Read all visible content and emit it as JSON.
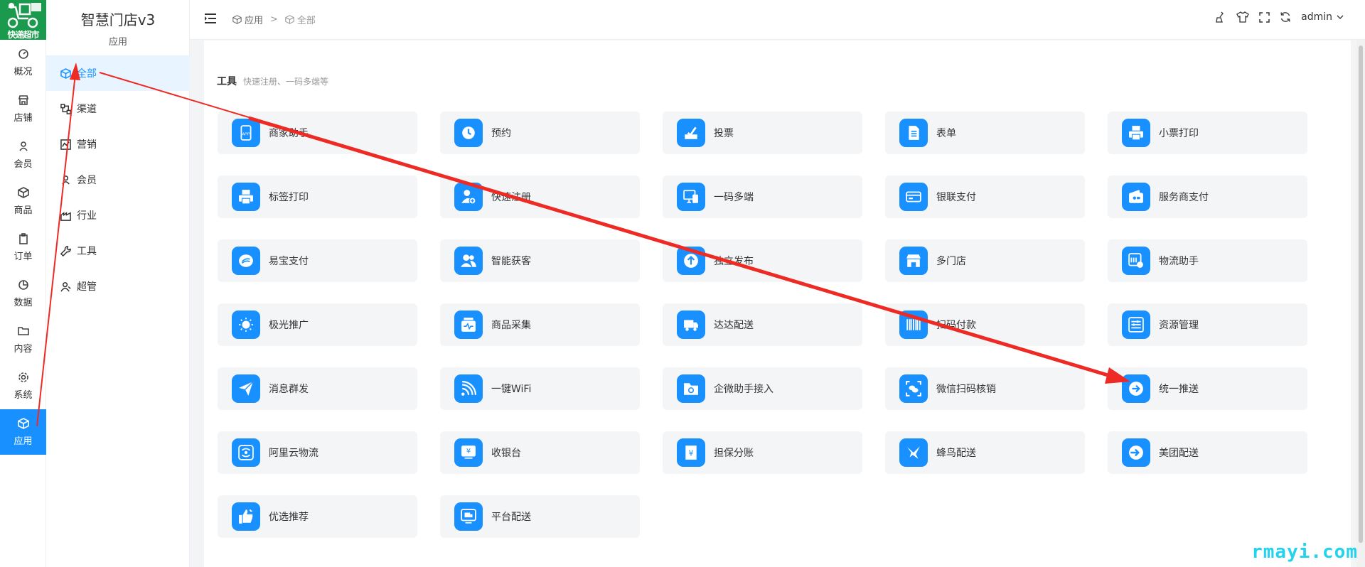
{
  "logo": {
    "text": "快递超市",
    "color": "#1a9a4c"
  },
  "rail": {
    "items": [
      {
        "label": "概况",
        "icon": "dashboard-icon"
      },
      {
        "label": "店铺",
        "icon": "shop-icon"
      },
      {
        "label": "会员",
        "icon": "user-icon"
      },
      {
        "label": "商品",
        "icon": "box-icon"
      },
      {
        "label": "订单",
        "icon": "clipboard-icon"
      },
      {
        "label": "数据",
        "icon": "pie-chart-icon"
      },
      {
        "label": "内容",
        "icon": "folder-icon"
      },
      {
        "label": "系统",
        "icon": "gear-icon"
      },
      {
        "label": "应用",
        "icon": "cube-icon",
        "active": true
      }
    ]
  },
  "sidebar": {
    "title": "智慧门店v3",
    "subtitle": "应用",
    "items": [
      {
        "label": "全部",
        "icon": "cube-icon",
        "active": true
      },
      {
        "label": "渠道",
        "icon": "channel-icon"
      },
      {
        "label": "营销",
        "icon": "chart-icon"
      },
      {
        "label": "会员",
        "icon": "user-icon"
      },
      {
        "label": "行业",
        "icon": "industry-icon"
      },
      {
        "label": "工具",
        "icon": "wrench-icon"
      },
      {
        "label": "超管",
        "icon": "admin-user-icon"
      }
    ]
  },
  "header": {
    "breadcrumb": [
      "应用",
      "全部"
    ],
    "breadcrumb_sep": ">",
    "user": "admin"
  },
  "section": {
    "title": "工具",
    "desc": "快速注册、一码多端等"
  },
  "apps": [
    {
      "label": "商家助手",
      "icon": "app-icon"
    },
    {
      "label": "预约",
      "icon": "clock-icon"
    },
    {
      "label": "投票",
      "icon": "vote-icon"
    },
    {
      "label": "表单",
      "icon": "form-icon"
    },
    {
      "label": "小票打印",
      "icon": "receipt-printer-icon"
    },
    {
      "label": "标签打印",
      "icon": "printer-icon"
    },
    {
      "label": "快速注册",
      "icon": "add-user-icon"
    },
    {
      "label": "一码多端",
      "icon": "devices-icon"
    },
    {
      "label": "银联支付",
      "icon": "card-icon"
    },
    {
      "label": "服务商支付",
      "icon": "wallet-icon"
    },
    {
      "label": "易宝支付",
      "icon": "pay-icon"
    },
    {
      "label": "智能获客",
      "icon": "users-icon"
    },
    {
      "label": "独立发布",
      "icon": "upload-icon"
    },
    {
      "label": "多门店",
      "icon": "store-icon"
    },
    {
      "label": "物流助手",
      "icon": "logistics-icon"
    },
    {
      "label": "极光推广",
      "icon": "aurora-icon"
    },
    {
      "label": "商品采集",
      "icon": "collect-icon"
    },
    {
      "label": "达达配送",
      "icon": "truck-icon"
    },
    {
      "label": "扫码付款",
      "icon": "barcode-icon"
    },
    {
      "label": "资源管理",
      "icon": "resource-icon"
    },
    {
      "label": "消息群发",
      "icon": "send-icon"
    },
    {
      "label": "一键WiFi",
      "icon": "wifi-icon"
    },
    {
      "label": "企微助手接入",
      "icon": "folder-sync-icon"
    },
    {
      "label": "微信扫码核销",
      "icon": "wechat-scan-icon"
    },
    {
      "label": "统一推送",
      "icon": "arrow-right-circle-icon"
    },
    {
      "label": "阿里云物流",
      "icon": "cloud-logistics-icon"
    },
    {
      "label": "收银台",
      "icon": "cashier-icon"
    },
    {
      "label": "担保分账",
      "icon": "guarantee-icon"
    },
    {
      "label": "蜂鸟配送",
      "icon": "hummingbird-icon"
    },
    {
      "label": "美团配送",
      "icon": "meituan-icon"
    },
    {
      "label": "优选推荐",
      "icon": "thumbs-up-icon"
    },
    {
      "label": "平台配送",
      "icon": "platform-delivery-icon"
    }
  ],
  "watermark": "rmayi.com",
  "colors": {
    "accent": "#1890ff",
    "annotation": "#ee2a24",
    "watermark": "#22d3ee"
  }
}
